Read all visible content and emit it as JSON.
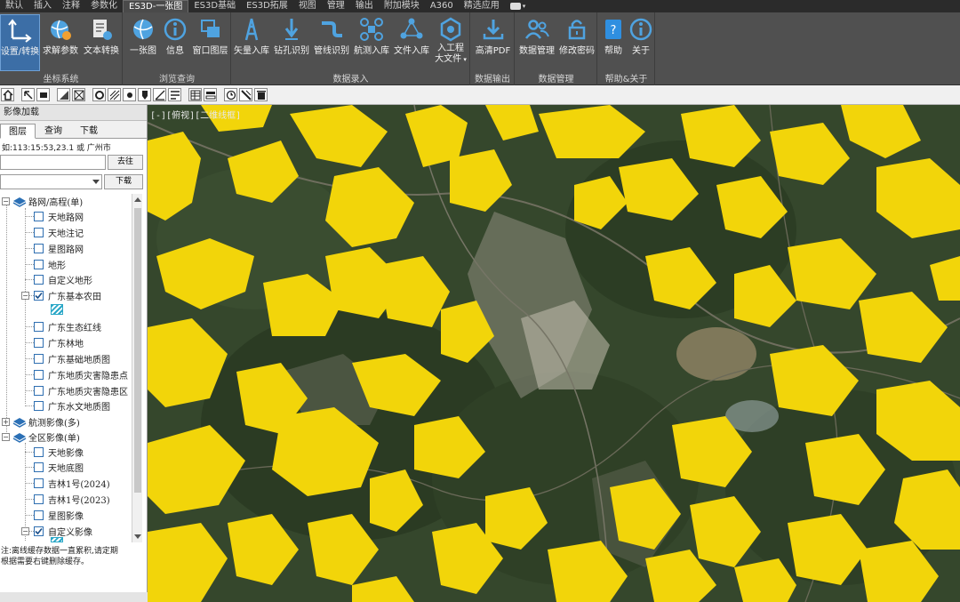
{
  "menubar": {
    "items": [
      "默认",
      "插入",
      "注释",
      "参数化",
      "ES3D-一张图",
      "ES3D基础",
      "ES3D拓展",
      "视图",
      "管理",
      "输出",
      "附加模块",
      "A360",
      "精选应用"
    ],
    "active_index": 4
  },
  "ribbon": {
    "buttons": {
      "coord_set": "设置/转换",
      "solve_params": "求解参数",
      "text_convert": "文本转换",
      "one_map": "一张图",
      "info": "信息",
      "window_layer": "窗口图层",
      "vector_import": "矢量入库",
      "drill_recognize": "钻孔识别",
      "pipeline_recognize": "管线识别",
      "aerial_import": "航测入库",
      "file_import": "文件入库",
      "project_file_line1": "入工程",
      "project_file_line2": "大文件",
      "hd_pdf": "高清PDF",
      "data_manage": "数据管理",
      "change_password": "修改密码",
      "help": "帮助",
      "about": "关于"
    },
    "groups": {
      "coord_system": "坐标系统",
      "browse_query": "浏览查询",
      "data_entry": "数据录入",
      "data_output": "数据输出",
      "data_management": "数据管理",
      "help_about": "帮助&关于"
    }
  },
  "panel": {
    "title": "影像加载",
    "tabs": [
      "图层",
      "查询",
      "下载"
    ],
    "active_tab": 0,
    "coord_hint": "如:113:15:53,23.1 或 广州市",
    "goto_label": "去往",
    "download_label": "下载",
    "tree": {
      "road_group": "路网/高程(单)",
      "road_items": [
        "天地路网",
        "天地注记",
        "星图路网",
        "地形",
        "自定义地形",
        "广东基本农田"
      ],
      "road_checked": [
        false,
        false,
        false,
        false,
        false,
        true
      ],
      "gd_items": [
        "广东生态红线",
        "广东林地",
        "广东基础地质图",
        "广东地质灾害隐患点",
        "广东地质灾害隐患区",
        "广东水文地质图"
      ],
      "aerial_group": "航测影像(多)",
      "full_group": "全区影像(单)",
      "full_items": [
        "天地影像",
        "天地底图",
        "吉林1号(2024)",
        "吉林1号(2023)",
        "星图影像",
        "自定义影像"
      ],
      "full_checked": [
        false,
        false,
        false,
        false,
        false,
        true
      ]
    },
    "notice_line1": "注:离线缓存数据一直累积,请定期",
    "notice_line2": "根据需要右键删除缓存。"
  },
  "map": {
    "view_label": "[-][俯视][二维线框]",
    "overlay_color": "#f2d50a",
    "base_color": "#35472c"
  },
  "colors": {
    "ribbon_bg": "#505050",
    "menubar_bg": "#2b2b2b",
    "accent": "#3c6ea6"
  }
}
